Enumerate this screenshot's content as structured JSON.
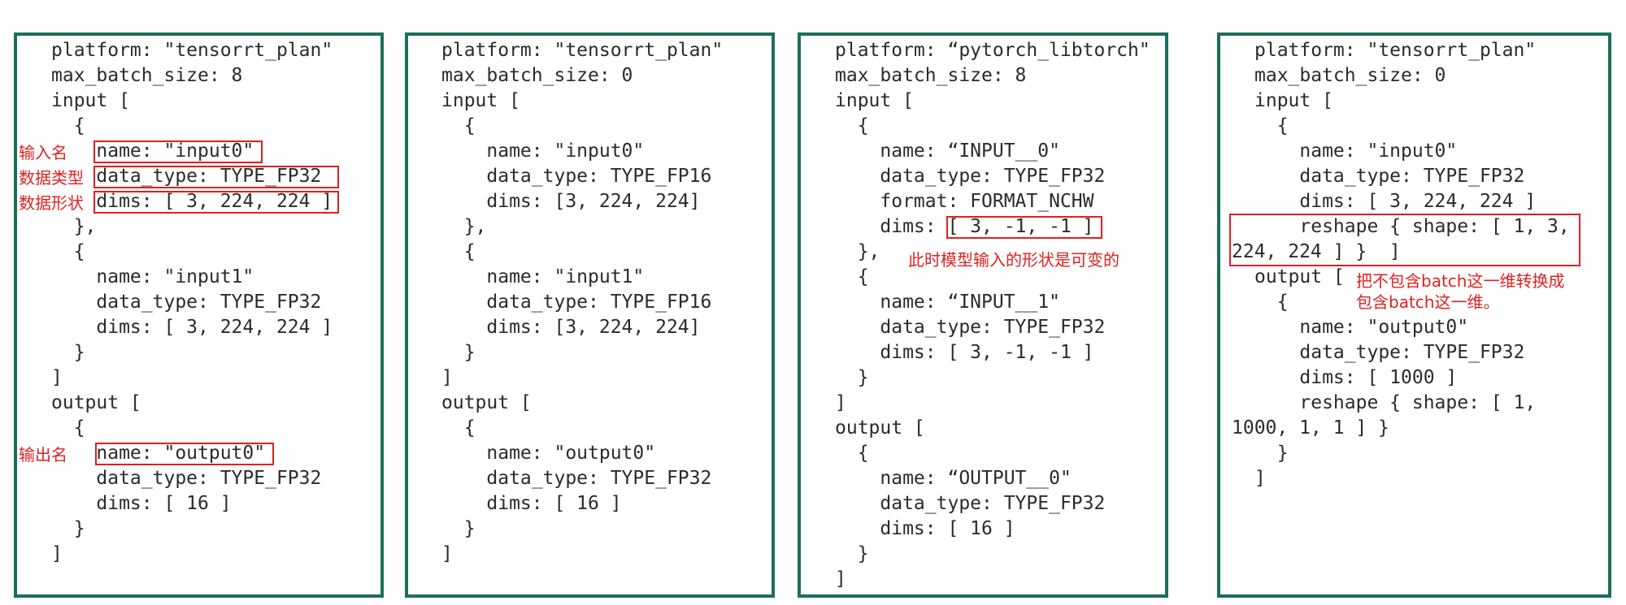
{
  "panels": [
    {
      "lines": [
        "platform: \"tensorrt_plan\"",
        "max_batch_size: 8",
        "input [",
        "  {",
        "    name: \"input0\"",
        "    data_type: TYPE_FP32",
        "    dims: [ 3, 224, 224 ]",
        "  },",
        "  {",
        "    name: \"input1\"",
        "    data_type: TYPE_FP32",
        "    dims: [ 3, 224, 224 ]",
        "  }",
        "]",
        "output [",
        "  {",
        "    name: \"output0\"",
        "    data_type: TYPE_FP32",
        "    dims: [ 16 ]",
        "  }",
        "]"
      ],
      "annotations": [
        "输入名",
        "数据类型",
        "数据形状",
        "输出名"
      ]
    },
    {
      "lines": [
        "platform: \"tensorrt_plan\"",
        "max_batch_size: 0",
        "input [",
        "  {",
        "    name: \"input0\"",
        "    data_type: TYPE_FP16",
        "    dims: [3, 224, 224]",
        "  },",
        "  {",
        "    name: \"input1\"",
        "    data_type: TYPE_FP16",
        "    dims: [3, 224, 224]",
        "  }",
        "]",
        "output [",
        "  {",
        "    name: \"output0\"",
        "    data_type: TYPE_FP32",
        "    dims: [ 16 ]",
        "  }",
        "]"
      ]
    },
    {
      "lines": [
        "platform: “pytorch_libtorch\"",
        "max_batch_size: 8",
        "input [",
        "  {",
        "    name: “INPUT__0\"",
        "    data_type: TYPE_FP32",
        "    format: FORMAT_NCHW",
        "    dims: [ 3, -1, -1 ]",
        "  },",
        "  {",
        "    name: “INPUT__1\"",
        "    data_type: TYPE_FP32",
        "    dims: [ 3, -1, -1 ]",
        "  }",
        "]",
        "output [",
        "  {",
        "    name: “OUTPUT__0\"",
        "    data_type: TYPE_FP32",
        "    dims: [ 16 ]",
        "  }",
        "]"
      ],
      "annotations": [
        "此时模型输入的形状是可变的"
      ]
    },
    {
      "lines": [
        "platform: \"tensorrt_plan\"",
        "max_batch_size: 0",
        "input [",
        "  {",
        "    name: \"input0\"",
        "    data_type: TYPE_FP32",
        "    dims: [ 3, 224, 224 ]",
        "    reshape { shape: [ 1, 3,",
        "224, 224 ] }  ]",
        "output [",
        "  {",
        "    name: \"output0\"",
        "    data_type: TYPE_FP32",
        "    dims: [ 1000 ]",
        "    reshape { shape: [ 1,",
        "1000, 1, 1 ] }",
        "  }",
        "]"
      ],
      "annotations": [
        "把不包含batch这一维转换成",
        "包含batch这一维。"
      ]
    }
  ],
  "colors": {
    "panel_border": "#1b6e5b",
    "annotation": "#e02020",
    "code_text": "#2b2b2b"
  }
}
